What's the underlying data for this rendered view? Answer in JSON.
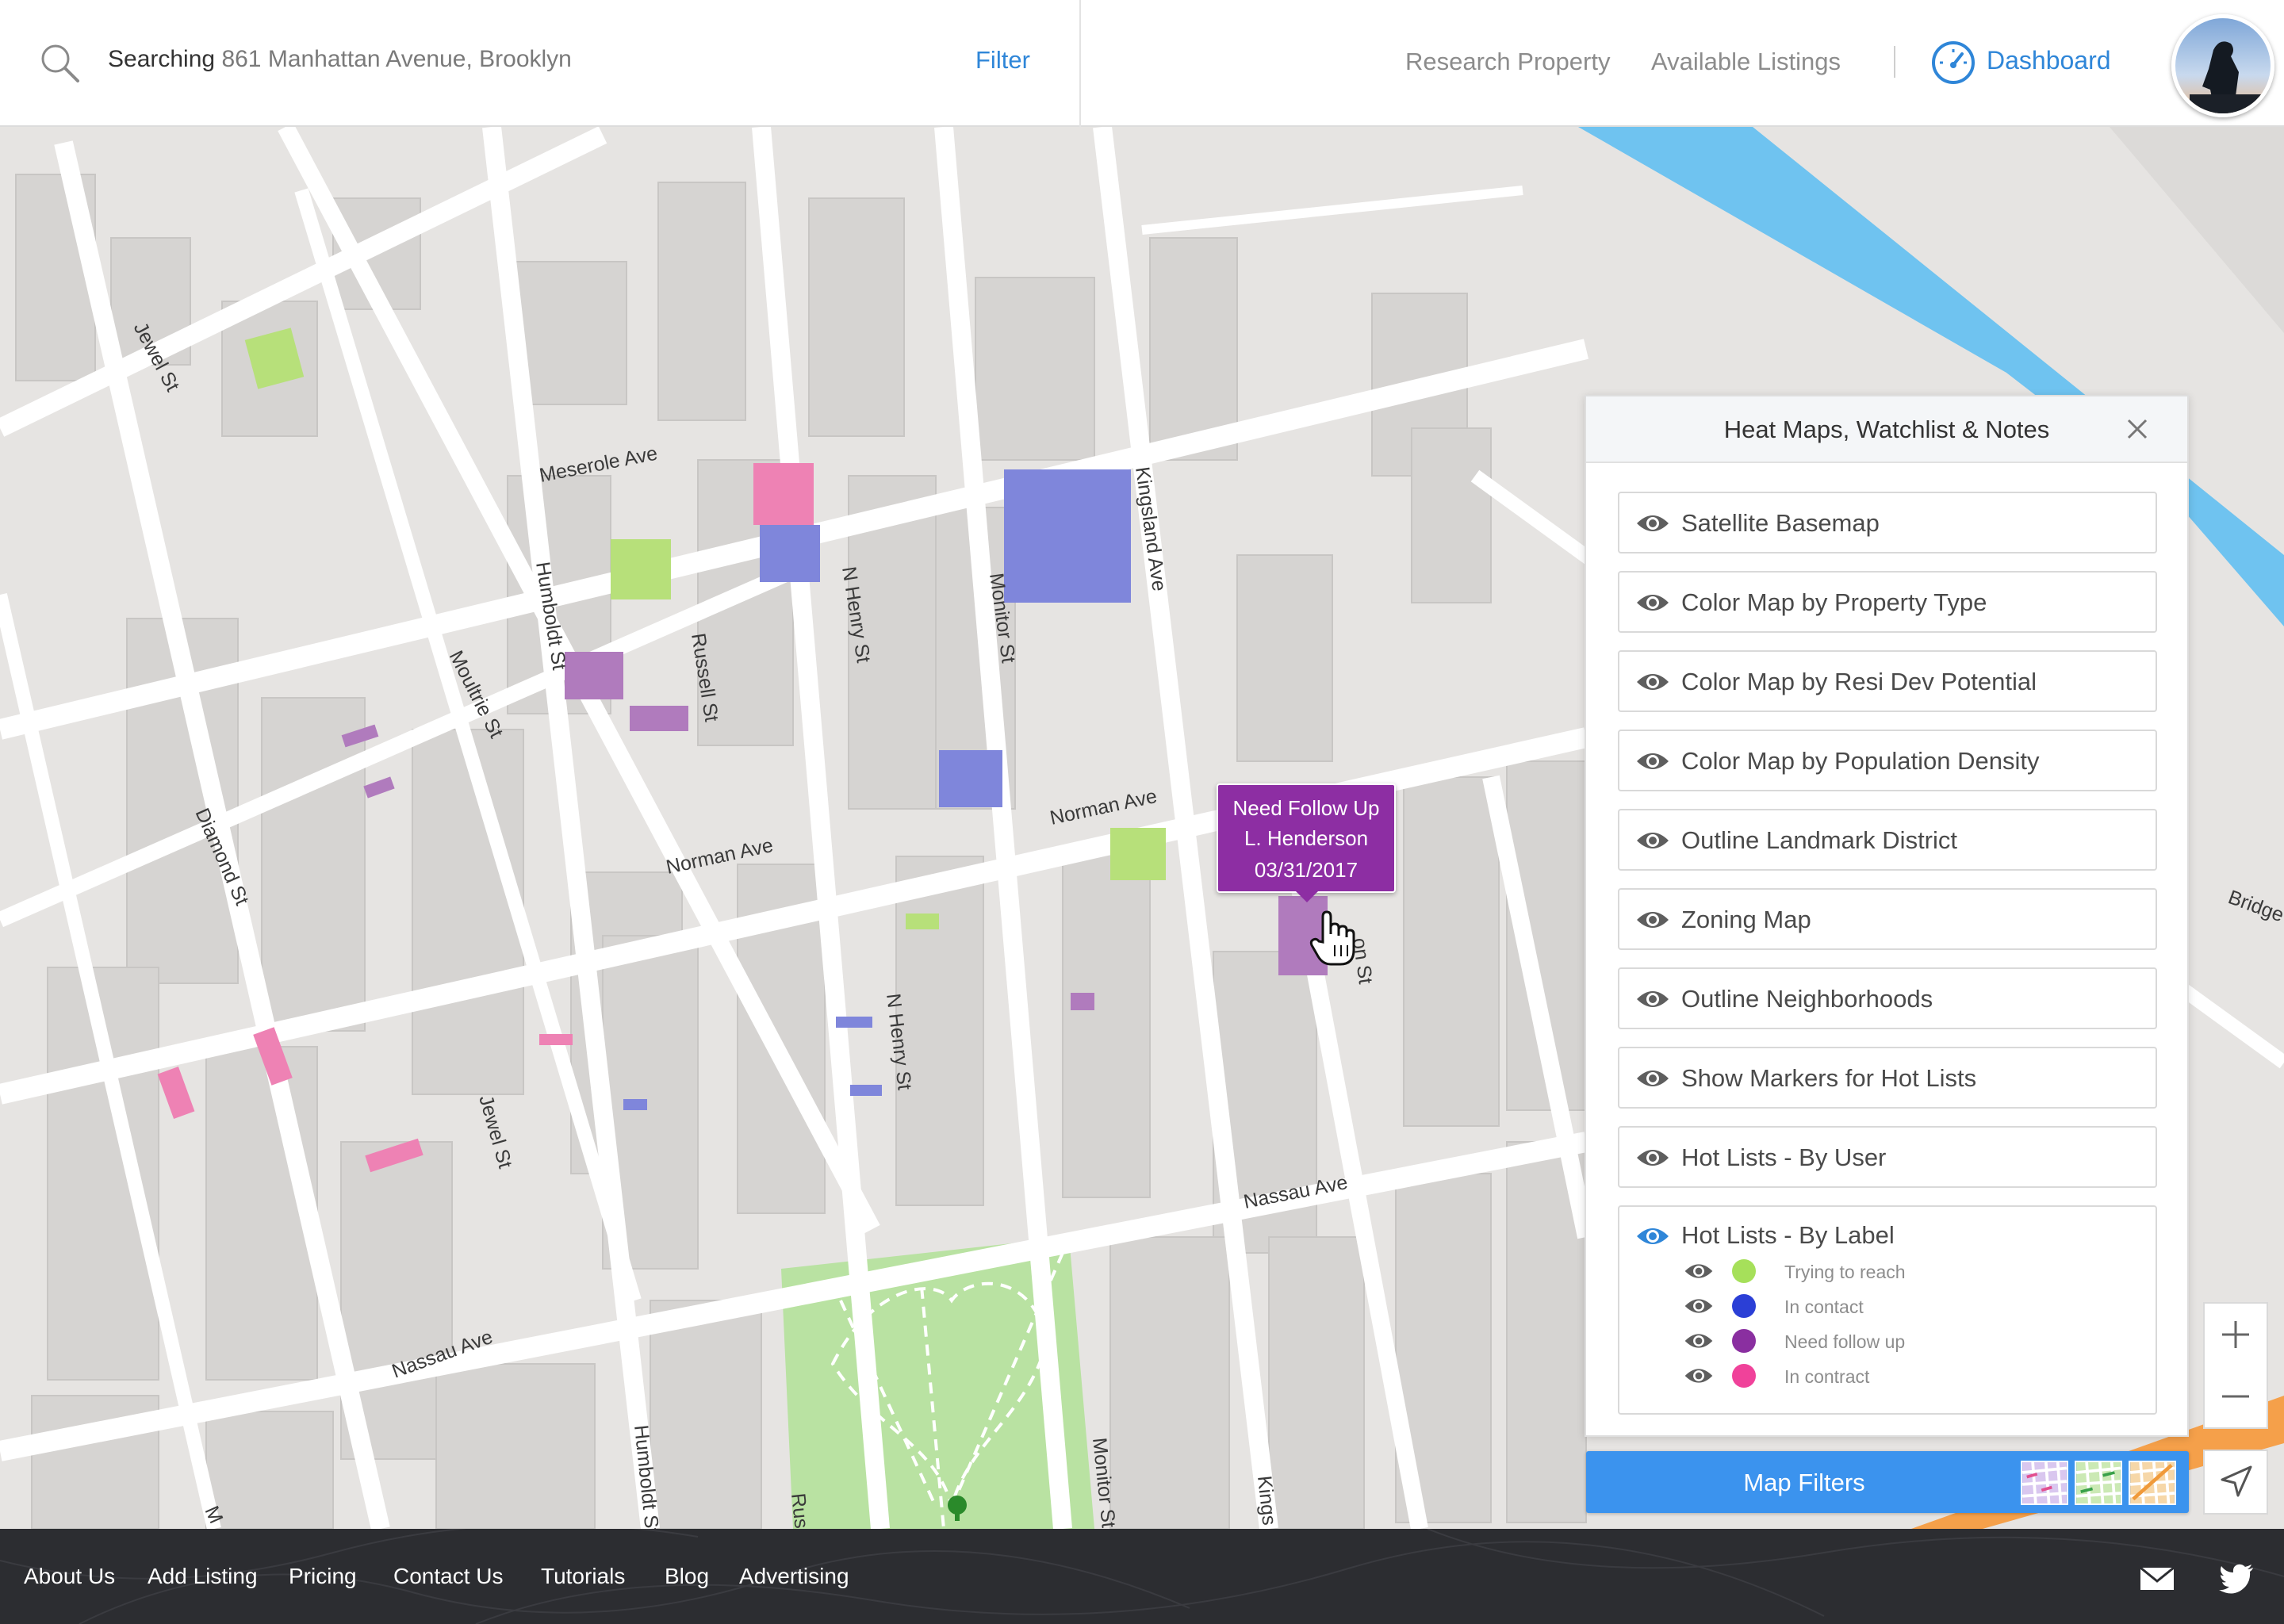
{
  "header": {
    "search_lead": "Searching",
    "search_value": "861 Manhattan Avenue, Brooklyn",
    "filter_label": "Filter",
    "nav": [
      "Research Property",
      "Available Listings"
    ],
    "dashboard_label": "Dashboard",
    "icons": [
      "search-icon",
      "dashboard-gauge-icon",
      "user-avatar"
    ]
  },
  "map": {
    "streets": [
      "Jewel St",
      "Meserole Ave",
      "Humboldt St",
      "Russell St",
      "N Henry St",
      "Monitor St",
      "Kingsland Ave",
      "Moultrie St",
      "Diamond St",
      "Norman Ave",
      "Nassau Ave",
      "Jewel St",
      "N Henry St",
      "Humboldt St",
      "Monitor St",
      "Kings",
      "on St",
      "Bridge",
      "Rus",
      "M"
    ],
    "colors": {
      "trying_to_reach": "#b7e07a",
      "in_contact": "#7f86db",
      "need_follow_up": "#b07bbd",
      "in_contract": "#ee82b4",
      "park": "#b9e2a2",
      "water": "#6fc3f0"
    }
  },
  "popup": {
    "line1": "Need Follow Up",
    "line2": "L. Henderson",
    "line3": "03/31/2017",
    "color": "#8d2ea3"
  },
  "panel": {
    "title": "Heat Maps, Watchlist & Notes",
    "layers": [
      "Satellite Basemap",
      "Color Map by Property Type",
      "Color Map by Resi Dev Potential",
      "Color Map by Population Density",
      "Outline Landmark District",
      "Zoning Map",
      "Outline Neighborhoods",
      "Show Markers for Hot Lists",
      "Hot Lists - By User"
    ],
    "label_group": {
      "title": "Hot Lists - By Label",
      "labels": [
        {
          "text": "Trying to reach",
          "color": "#a6e05a"
        },
        {
          "text": "In contact",
          "color": "#2b3fd6"
        },
        {
          "text": "Need follow up",
          "color": "#8a2fa0"
        },
        {
          "text": "In contract",
          "color": "#f0429a"
        }
      ]
    }
  },
  "map_filters": {
    "label": "Map Filters"
  },
  "footer": {
    "links": [
      "About Us",
      "Add Listing",
      "Pricing",
      "Contact Us",
      "Tutorials",
      "Blog",
      "Advertising"
    ]
  }
}
